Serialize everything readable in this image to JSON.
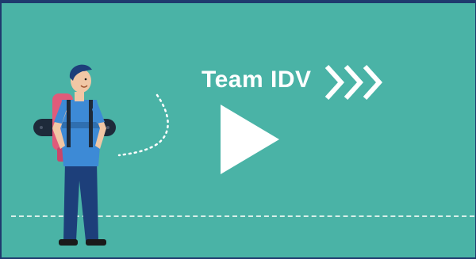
{
  "video": {
    "title": "Team IDV",
    "icons": {
      "play": "play-icon",
      "chevrons": "triple-chevron-right-icon"
    },
    "colors": {
      "background": "#4ab3a6",
      "border": "#1f3a6e",
      "accent": "#ffffff"
    }
  }
}
